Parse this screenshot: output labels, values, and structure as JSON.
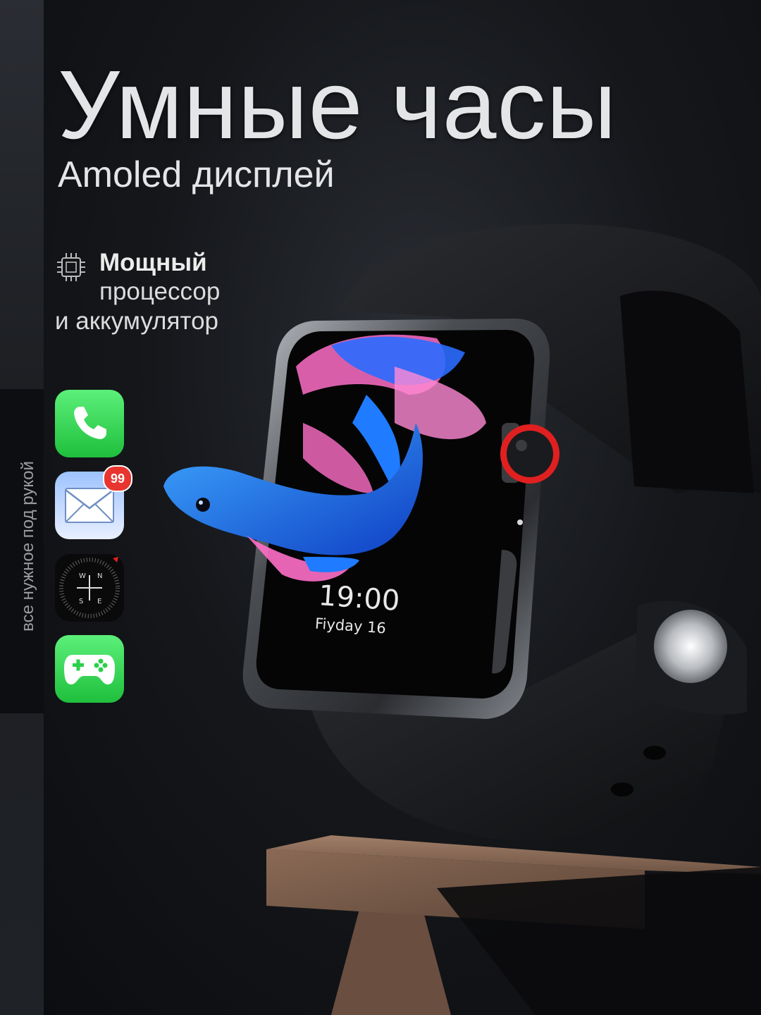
{
  "headline": {
    "title": "Умные часы",
    "subtitle": "Amoled дисплей"
  },
  "feature": {
    "icon": "cpu-chip-icon",
    "line1": "Мощный",
    "line2": "процессор",
    "line3": "и аккумулятор"
  },
  "side_caption": "все нужное под рукой",
  "apps": [
    {
      "icon": "phone-icon"
    },
    {
      "icon": "mail-icon",
      "badge": "99"
    },
    {
      "icon": "compass-icon",
      "letters": [
        "W",
        "N",
        "S",
        "E"
      ]
    },
    {
      "icon": "gamepad-icon"
    }
  ],
  "watch_face": {
    "time": "19:00",
    "date": "Fiyday 16"
  },
  "colors": {
    "background": "#15171b",
    "app_green": "#2ad04a",
    "badge_red": "#e8352f",
    "crown_red": "#e02020",
    "fish_blue": "#1f7bff",
    "fish_pink": "#ff6fc8"
  }
}
